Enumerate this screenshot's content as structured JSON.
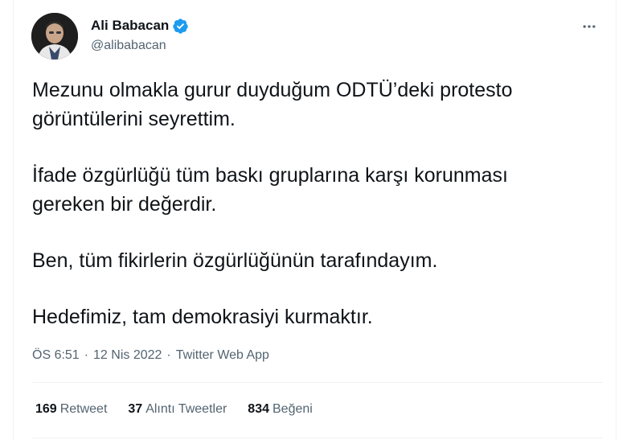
{
  "tweet": {
    "author": {
      "name": "Ali Babacan",
      "handle": "@alibabacan",
      "verified_icon": "verified-badge-icon"
    },
    "more_icon": "more-horizontal-icon",
    "paragraphs": [
      {
        "lines": [
          "Mezunu olmakla gurur duyduğum ODTÜ’deki protesto",
          "görüntülerini seyrettim."
        ]
      },
      {
        "lines": [
          "İfade özgürlüğü tüm baskı gruplarına karşı korunması",
          "gereken bir değerdir."
        ]
      },
      {
        "lines": [
          "Ben, tüm fikirlerin özgürlüğünün tarafındayım."
        ]
      },
      {
        "lines": [
          "Hedefimiz, tam demokrasiyi kurmaktır."
        ]
      }
    ],
    "meta": {
      "time": "ÖS 6:51",
      "separator": "·",
      "date": "12 Nis 2022",
      "source": "Twitter Web App"
    },
    "stats": {
      "retweets": {
        "count": "169",
        "label": "Retweet"
      },
      "quotes": {
        "count": "37",
        "label": "Alıntı Tweetler"
      },
      "likes": {
        "count": "834",
        "label": "Beğeni"
      }
    }
  },
  "colors": {
    "text_primary": "#0f1419",
    "text_secondary": "#536471",
    "verified_blue": "#1d9bf0",
    "divider": "#eff3f4"
  }
}
